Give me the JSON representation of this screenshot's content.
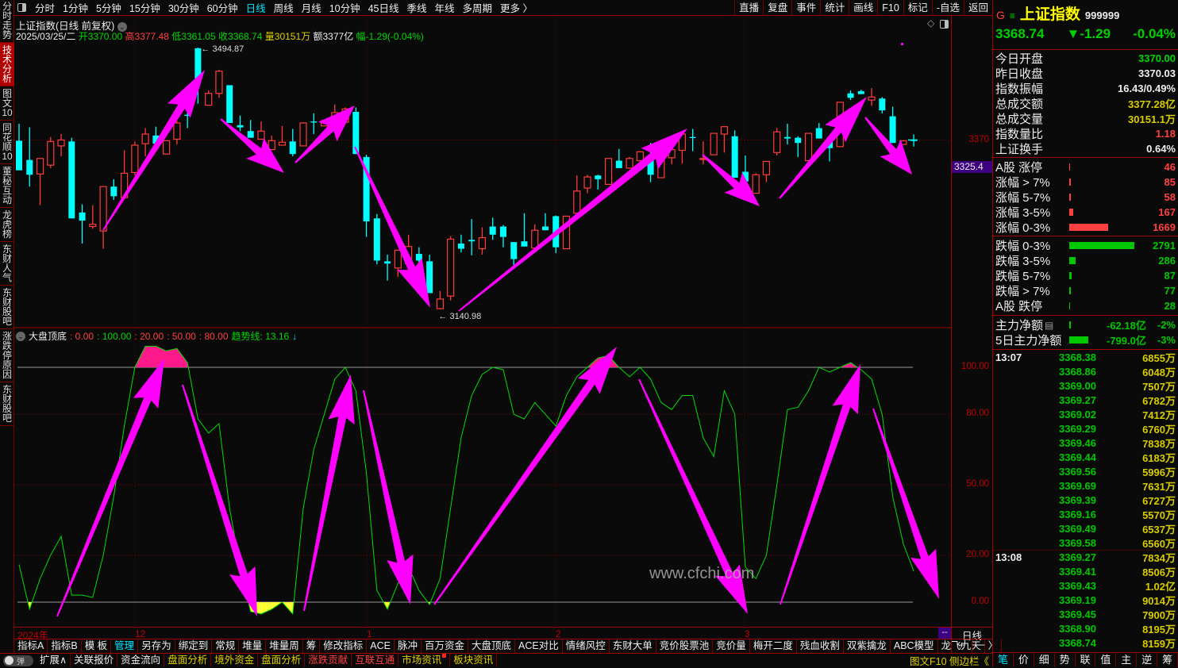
{
  "left_tabs": [
    {
      "label": "分时走势",
      "active": false
    },
    {
      "label": "技术分析",
      "active": true
    },
    {
      "label": "图文10",
      "active": false
    },
    {
      "label": "同花顺10",
      "active": false
    },
    {
      "label": "董秘互动",
      "active": false
    },
    {
      "label": "龙虎榜",
      "active": false
    },
    {
      "label": "东财人气",
      "active": false
    },
    {
      "label": "东财股吧",
      "active": false
    },
    {
      "label": "涨跌停原因",
      "active": false
    },
    {
      "label": "东财股吧",
      "active": false
    }
  ],
  "toolbar": {
    "periods": [
      "分时",
      "1分钟",
      "5分钟",
      "15分钟",
      "30分钟",
      "60分钟",
      "日线",
      "周线",
      "月线",
      "10分钟",
      "45日线",
      "季线",
      "年线",
      "多周期",
      "更多 〉"
    ],
    "active_period": "日线",
    "right": [
      "直播",
      "复盘",
      "事件",
      "统计",
      "画线",
      "F10",
      "标记",
      "-自选",
      "返回"
    ]
  },
  "info": {
    "title": "上证指数(日线 前复权)",
    "date": "2025/03/25/二",
    "open_label": "开",
    "open": "3370.00",
    "high_label": "高",
    "high": "3377.48",
    "low_label": "低",
    "low": "3361.05",
    "close_label": "收",
    "close": "3368.74",
    "vol_label": "量",
    "vol": "30151万",
    "amt_label": "额",
    "amt": "3377亿",
    "chg_label": "幅",
    "chg": "-1.29(-0.04%)"
  },
  "price_chart": {
    "max_label": "3494.87",
    "min_label": "3140.98",
    "axis_label": "3370",
    "current_box": "3325.4",
    "colors": {
      "up": "#ff3b3b",
      "down": "#00ffff",
      "annotation_arrow": "#ff00ff"
    },
    "candles_ohlc": [
      [
        3369,
        3392,
        3329,
        3329
      ],
      [
        3343,
        3387,
        3307,
        3323
      ],
      [
        3324,
        3345,
        3282,
        3345
      ],
      [
        3336,
        3374,
        3332,
        3368
      ],
      [
        3362,
        3378,
        3348,
        3370
      ],
      [
        3368,
        3373,
        3264,
        3264
      ],
      [
        3272,
        3283,
        3230,
        3261
      ],
      [
        3253,
        3282,
        3250,
        3256
      ],
      [
        3247,
        3307,
        3223,
        3307
      ],
      [
        3307,
        3317,
        3289,
        3294
      ],
      [
        3292,
        3356,
        3292,
        3325
      ],
      [
        3326,
        3368,
        3322,
        3363
      ],
      [
        3365,
        3386,
        3348,
        3378
      ],
      [
        3376,
        3388,
        3365,
        3365
      ],
      [
        3351,
        3369,
        3351,
        3369
      ],
      [
        3371,
        3396,
        3364,
        3393
      ],
      [
        3404,
        3409,
        3386,
        3403
      ],
      [
        3494,
        3494.87,
        3419,
        3453
      ],
      [
        3417,
        3437,
        3417,
        3433
      ],
      [
        3433,
        3465,
        3427,
        3463
      ],
      [
        3444,
        3444,
        3393,
        3393
      ],
      [
        3390,
        3403,
        3382,
        3387
      ],
      [
        3382,
        3397,
        3373,
        3373
      ],
      [
        3371,
        3395,
        3371,
        3382
      ],
      [
        3357,
        3376,
        3357,
        3369
      ],
      [
        3363,
        3389,
        3363,
        3367
      ],
      [
        3368,
        3385,
        3348,
        3351
      ],
      [
        3362,
        3394,
        3362,
        3393
      ],
      [
        3395,
        3406,
        3378,
        3394
      ],
      [
        3389,
        3396,
        3389,
        3396
      ],
      [
        3396,
        3418,
        3396,
        3407
      ],
      [
        3394,
        3414,
        3394,
        3412
      ],
      [
        3408,
        3414,
        3351,
        3351
      ],
      [
        3347,
        3350,
        3239,
        3260
      ],
      [
        3264,
        3270,
        3202,
        3207
      ],
      [
        3206,
        3215,
        3180,
        3203
      ],
      [
        3197,
        3221,
        3185,
        3221
      ],
      [
        3203,
        3242,
        3203,
        3226
      ],
      [
        3216,
        3225,
        3202,
        3207
      ],
      [
        3206,
        3215,
        3163,
        3163
      ],
      [
        3142,
        3166,
        3140.98,
        3155
      ],
      [
        3159,
        3240,
        3153,
        3236
      ],
      [
        3230,
        3242,
        3218,
        3223
      ],
      [
        3235,
        3263,
        3214,
        3233
      ],
      [
        3223,
        3252,
        3215,
        3238
      ],
      [
        3253,
        3265,
        3235,
        3242
      ],
      [
        3253,
        3255,
        3225,
        3239
      ],
      [
        3232,
        3232,
        3201,
        3209
      ],
      [
        3233,
        3271,
        3226,
        3226
      ],
      [
        3224,
        3256,
        3224,
        3248
      ],
      [
        3253,
        3271,
        3248,
        3248
      ],
      [
        3267,
        3268,
        3217,
        3225
      ],
      [
        3223,
        3267,
        3223,
        3267
      ],
      [
        3271,
        3322,
        3271,
        3301
      ],
      [
        3305,
        3323,
        3298,
        3320
      ],
      [
        3322,
        3323,
        3303,
        3317
      ],
      [
        3310,
        3345,
        3310,
        3345
      ],
      [
        3342,
        3358,
        3332,
        3332
      ],
      [
        3332,
        3347,
        3332,
        3345
      ],
      [
        3342,
        3355,
        3342,
        3354
      ],
      [
        3342,
        3366,
        3313,
        3323
      ],
      [
        3319,
        3357,
        3319,
        3357
      ],
      [
        3346,
        3357,
        3337,
        3357
      ],
      [
        3356,
        3378,
        3338,
        3378
      ],
      [
        3374,
        3385,
        3355,
        3373
      ],
      [
        3344,
        3368,
        3337,
        3345
      ],
      [
        3350,
        3379,
        3350,
        3379
      ],
      [
        3378,
        3388,
        3353,
        3388
      ],
      [
        3375,
        3383,
        3319,
        3319
      ],
      [
        3327,
        3349,
        3314,
        3314
      ],
      [
        3298,
        3325,
        3298,
        3323
      ],
      [
        3323,
        3341,
        3313,
        3341
      ],
      [
        3353,
        3386,
        3349,
        3381
      ],
      [
        3374,
        3392,
        3364,
        3372
      ],
      [
        3373,
        3375,
        3347,
        3366
      ],
      [
        3342,
        3379,
        3342,
        3379
      ],
      [
        3386,
        3393,
        3372,
        3372
      ],
      [
        3368,
        3368,
        3341,
        3359
      ],
      [
        3361,
        3421,
        3361,
        3421
      ],
      [
        3433,
        3437,
        3424,
        3427
      ],
      [
        3436,
        3438,
        3432,
        3432
      ],
      [
        3424,
        3440,
        3416,
        3428
      ],
      [
        3426,
        3428,
        3406,
        3410
      ],
      [
        3402,
        3415,
        3366,
        3366
      ],
      [
        3364,
        3369,
        3364,
        3369
      ],
      [
        3370,
        3377.48,
        3361.05,
        3368.74
      ]
    ]
  },
  "indicator": {
    "name": "大盘顶底",
    "levels": [
      ": 0.00",
      ": 100.00",
      ": 20.00",
      ": 50.00",
      ": 80.00"
    ],
    "trend_label": "趋势线: 13.16",
    "trend_arrow": "↓",
    "axis_labels": [
      "100.00",
      "80.00",
      "50.00",
      "20.00",
      "0.00"
    ],
    "colors": {
      "line": "#00dd00",
      "overbought_fill": "#ff1a8c",
      "oversold_fill": "#ffff33"
    },
    "values": [
      16,
      -3,
      10,
      20,
      28,
      3,
      3,
      2,
      20,
      45,
      75,
      100,
      109,
      109,
      107,
      108,
      102,
      78,
      72,
      76,
      40,
      15,
      -4,
      -5,
      -3,
      0,
      -5,
      40,
      65,
      80,
      95,
      100,
      90,
      55,
      5,
      -3,
      8,
      15,
      5,
      -1,
      10,
      40,
      70,
      88,
      97,
      100,
      99,
      80,
      78,
      85,
      80,
      75,
      88,
      96,
      100,
      104,
      105,
      100,
      96,
      100,
      95,
      85,
      82,
      88,
      88,
      70,
      62,
      90,
      80,
      15,
      10,
      20,
      50,
      82,
      83,
      90,
      100,
      98,
      100,
      102,
      99,
      95,
      80,
      45,
      25,
      13.16
    ]
  },
  "watermark": "www.cfchi.com",
  "date_axis": {
    "labels": [
      "2024年",
      "12",
      "1",
      "2",
      "3"
    ],
    "period_box": "--",
    "period": "日线"
  },
  "tabs_row1": [
    "指标A",
    "指标B",
    "模 板",
    "管理",
    "另存为",
    "绑定到",
    "常规",
    "堆量",
    "堆量周",
    "筹",
    "修改指标",
    "ACE",
    "脉冲",
    "百万资金",
    "大盘顶底",
    "ACE对比",
    "情绪风控",
    "东财大单",
    "竞价股票池",
    "竞价量",
    "梅开二度",
    "残血收割",
    "双紫擒龙",
    "ABC模型",
    "龙飞九天",
    "〉"
  ],
  "tabs_row1_active": "管理",
  "zoom_buttons": [
    "+",
    "−"
  ],
  "tabs_row2": [
    {
      "label": "扩展∧",
      "color": "#eeeeee"
    },
    {
      "label": "关联报价",
      "color": "#eeeeee"
    },
    {
      "label": "资金流向",
      "color": "#eeeeee"
    },
    {
      "label": "盘面分析",
      "color": "#e0d000"
    },
    {
      "label": "境外资金",
      "color": "#e0d000"
    },
    {
      "label": "盘面分析",
      "color": "#e0d000"
    },
    {
      "label": "涨跌贡献",
      "color": "#ff4040"
    },
    {
      "label": "互联互通",
      "color": "#ff4040"
    },
    {
      "label": "市场资讯",
      "color": "#e0d000"
    },
    {
      "label": "板块资讯",
      "color": "#e0d000"
    }
  ],
  "toggle_label": "弹",
  "bottom_right": "图文F10 侧边栏《",
  "right_panel": {
    "g_label": "G",
    "menu_icon": "≡",
    "name": "上证指数",
    "code": "999999",
    "price": "3368.74",
    "change": "▼-1.29",
    "pct": "-0.04%",
    "stats": [
      {
        "label": "今日开盘",
        "value": "3370.00",
        "color": "#00d800"
      },
      {
        "label": "昨日收盘",
        "value": "3370.03",
        "color": "#eeeeee"
      },
      {
        "label": "指数振幅",
        "value": "16.43/0.49%",
        "color": "#eeeeee"
      },
      {
        "label": "总成交额",
        "value": "3377.28亿",
        "color": "#d8cc00"
      },
      {
        "label": "总成交量",
        "value": "30151.1万",
        "color": "#d8cc00"
      },
      {
        "label": "指数量比",
        "value": "1.18",
        "color": "#ff4040"
      },
      {
        "label": "上证换手",
        "value": "0.64%",
        "color": "#eeeeee"
      }
    ],
    "breadth": [
      {
        "label": "A股 涨停",
        "count": 46,
        "dir": "up"
      },
      {
        "label": "涨幅 > 7%",
        "count": 85,
        "dir": "up"
      },
      {
        "label": "涨幅 5-7%",
        "count": 58,
        "dir": "up"
      },
      {
        "label": "涨幅 3-5%",
        "count": 167,
        "dir": "up"
      },
      {
        "label": "涨幅 0-3%",
        "count": 1669,
        "dir": "up"
      },
      {
        "label": "跌幅 0-3%",
        "count": 2791,
        "dir": "down"
      },
      {
        "label": "跌幅 3-5%",
        "count": 286,
        "dir": "down"
      },
      {
        "label": "跌幅 5-7%",
        "count": 87,
        "dir": "down"
      },
      {
        "label": "跌幅 > 7%",
        "count": 77,
        "dir": "down"
      },
      {
        "label": "A股 跌停",
        "count": 28,
        "dir": "down"
      }
    ],
    "flows": [
      {
        "label": "主力净额",
        "amount": "-62.18亿",
        "amount_num": -62.18,
        "pct": "-2%"
      },
      {
        "label": "5日主力净额",
        "amount": "-799.0亿",
        "amount_num": -799.0,
        "pct": "-3%"
      }
    ],
    "ticks": [
      {
        "time": "13:07",
        "price": "3368.38",
        "vol": "6855万"
      },
      {
        "time": "",
        "price": "3368.86",
        "vol": "6048万"
      },
      {
        "time": "",
        "price": "3369.00",
        "vol": "7507万"
      },
      {
        "time": "",
        "price": "3369.27",
        "vol": "6782万"
      },
      {
        "time": "",
        "price": "3369.02",
        "vol": "7412万"
      },
      {
        "time": "",
        "price": "3369.29",
        "vol": "6760万"
      },
      {
        "time": "",
        "price": "3369.46",
        "vol": "7838万"
      },
      {
        "time": "",
        "price": "3369.44",
        "vol": "6183万"
      },
      {
        "time": "",
        "price": "3369.56",
        "vol": "5996万"
      },
      {
        "time": "",
        "price": "3369.69",
        "vol": "7631万"
      },
      {
        "time": "",
        "price": "3369.39",
        "vol": "6727万"
      },
      {
        "time": "",
        "price": "3369.16",
        "vol": "5570万"
      },
      {
        "time": "",
        "price": "3369.49",
        "vol": "6537万"
      },
      {
        "time": "",
        "price": "3369.58",
        "vol": "6560万"
      },
      {
        "time": "13:08",
        "price": "3369.27",
        "vol": "7834万"
      },
      {
        "time": "",
        "price": "3369.41",
        "vol": "8506万"
      },
      {
        "time": "",
        "price": "3369.43",
        "vol": "1.02亿"
      },
      {
        "time": "",
        "price": "3369.19",
        "vol": "9014万"
      },
      {
        "time": "",
        "price": "3369.45",
        "vol": "7900万"
      },
      {
        "time": "",
        "price": "3368.90",
        "vol": "8195万"
      },
      {
        "time": "",
        "price": "3368.74",
        "vol": "8159万"
      }
    ],
    "tabs": [
      "笔",
      "价",
      "细",
      "势",
      "联",
      "值",
      "主",
      "逆",
      "筹"
    ],
    "active_tab": "笔"
  }
}
